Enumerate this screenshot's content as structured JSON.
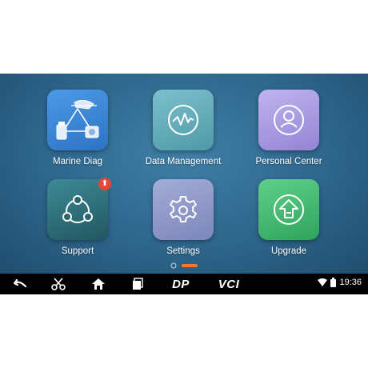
{
  "apps": [
    {
      "label": "Marine Diag",
      "icon": "marine-diag-icon",
      "color": "#3b86d6"
    },
    {
      "label": "Data Management",
      "icon": "waveform-icon",
      "color": "#5fa9b6"
    },
    {
      "label": "Personal Center",
      "icon": "user-icon",
      "color": "#a99be0"
    },
    {
      "label": "Support",
      "icon": "support-icon",
      "color": "#2c6d78",
      "badge": "⬆"
    },
    {
      "label": "Settings",
      "icon": "gear-icon",
      "color": "#8d97c8"
    },
    {
      "label": "Upgrade",
      "icon": "upgrade-icon",
      "color": "#3fb86d"
    }
  ],
  "pager": {
    "pages": 2,
    "active": 2
  },
  "navbar": {
    "brand_dp": "DP",
    "brand_vci": "VCI",
    "time": "19:36",
    "icons": [
      "back-icon",
      "scissors-icon",
      "home-icon",
      "recent-apps-icon",
      "wifi-icon",
      "battery-icon"
    ]
  }
}
